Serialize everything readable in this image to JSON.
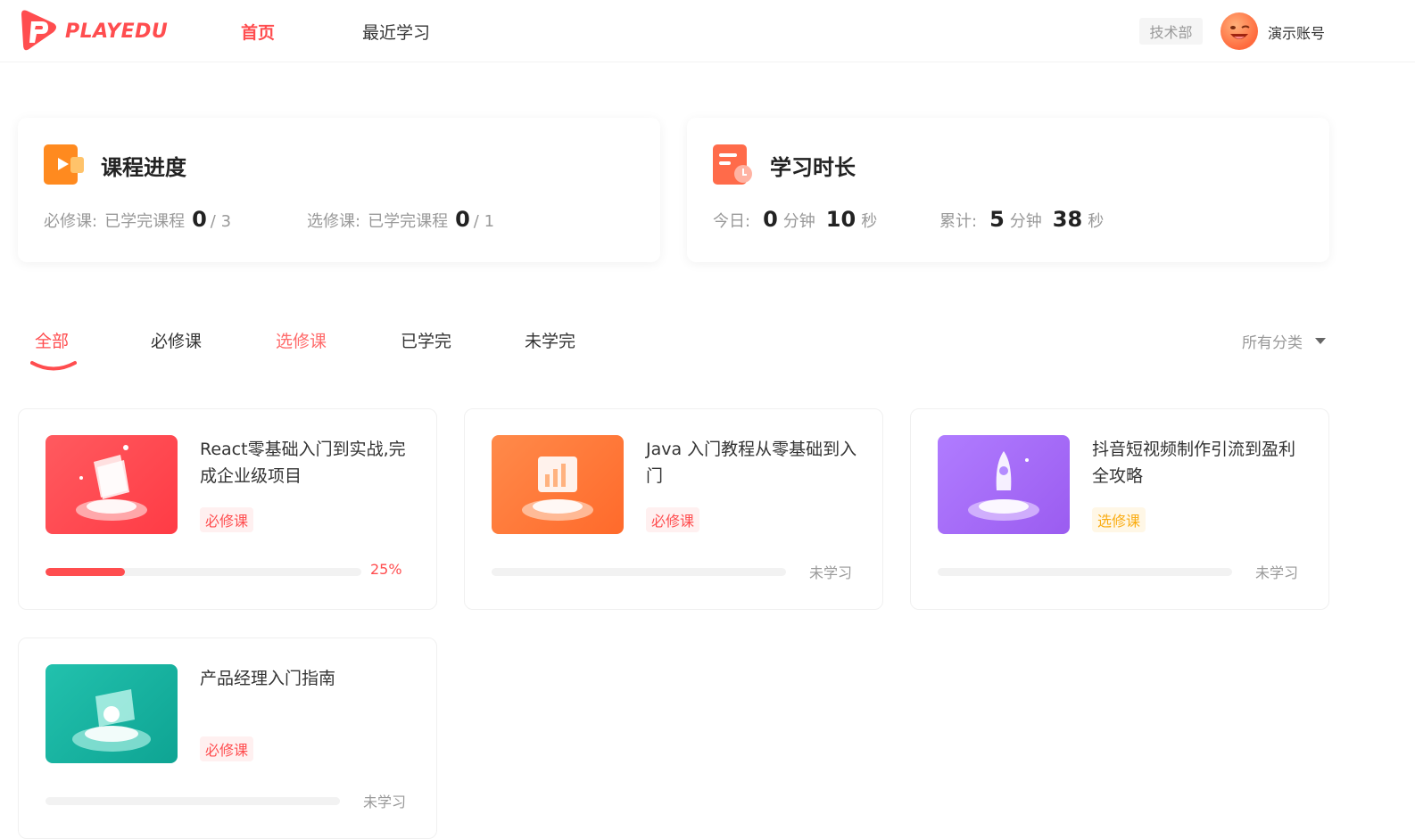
{
  "header": {
    "logo_text": "PLAYEDU",
    "nav": [
      {
        "label": "首页",
        "active": true
      },
      {
        "label": "最近学习",
        "active": false
      }
    ],
    "department": "技术部",
    "username": "演示账号"
  },
  "stats": {
    "progress": {
      "title": "课程进度",
      "required_label": "必修课:",
      "required_sub": "已学完课程",
      "required_done": "0",
      "required_total": "/ 3",
      "elective_label": "选修课:",
      "elective_sub": "已学完课程",
      "elective_done": "0",
      "elective_total": "/ 1"
    },
    "duration": {
      "title": "学习时长",
      "today_label": "今日:",
      "today_min": "0",
      "today_sec": "10",
      "total_label": "累计:",
      "total_min": "5",
      "total_sec": "38",
      "min_unit": "分钟",
      "sec_unit": "秒"
    }
  },
  "tabs": [
    {
      "label": "全部",
      "active": true
    },
    {
      "label": "必修课",
      "active": false
    },
    {
      "label": "选修课",
      "active": false
    },
    {
      "label": "已学完",
      "active": false
    },
    {
      "label": "未学完",
      "active": false
    }
  ],
  "category_filter": "所有分类",
  "courses": [
    {
      "title": "React零基础入门到实战,完成企业级项目",
      "tag": "必修课",
      "tag_type": "required",
      "progress": 25,
      "progress_label": "25%",
      "color": "#ff4d4f"
    },
    {
      "title": "Java 入门教程从零基础到入门",
      "tag": "必修课",
      "tag_type": "required",
      "progress": 0,
      "progress_label": "未学习",
      "color": "#ff7a45"
    },
    {
      "title": "抖音短视频制作引流到盈利全攻略",
      "tag": "选修课",
      "tag_type": "elective",
      "progress": 0,
      "progress_label": "未学习",
      "color": "#a66bf5"
    },
    {
      "title": "产品经理入门指南",
      "tag": "必修课",
      "tag_type": "required",
      "progress": 0,
      "progress_label": "未学习",
      "color": "#15b8a6"
    }
  ]
}
